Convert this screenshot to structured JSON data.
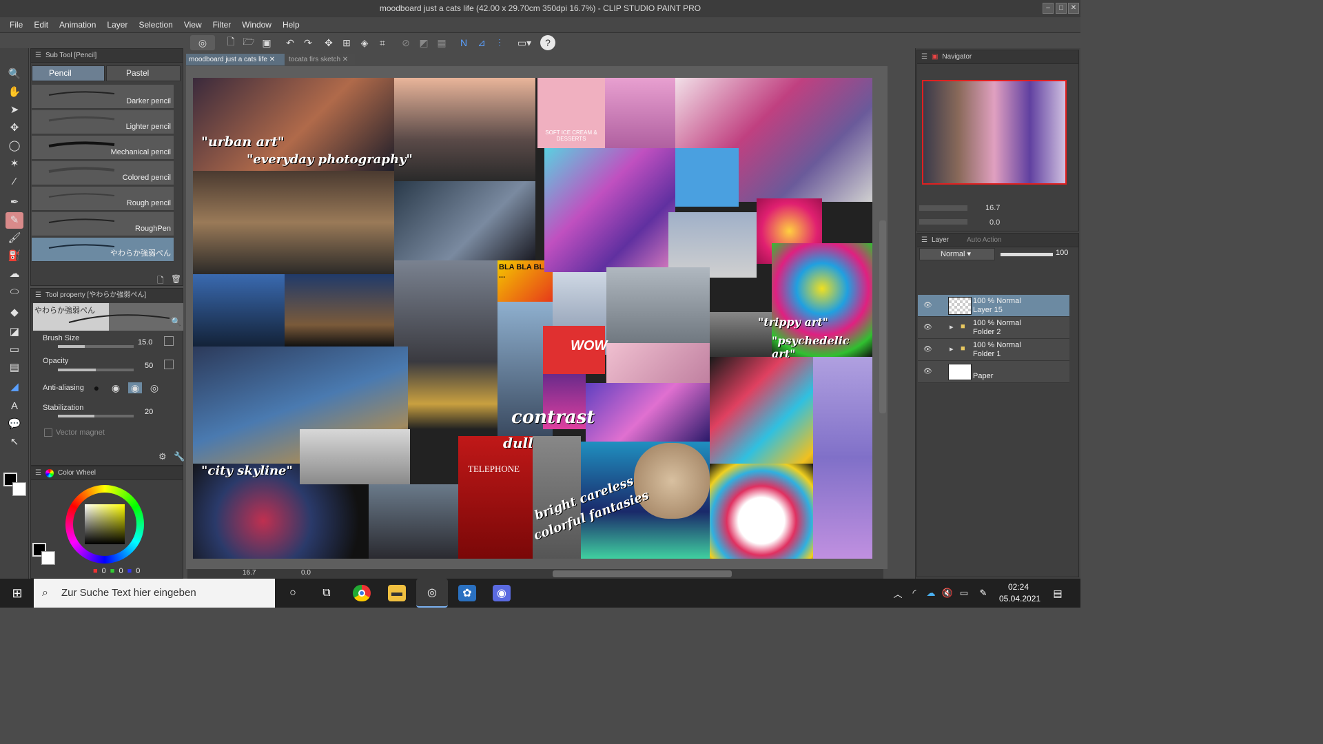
{
  "window": {
    "title": "moodboard just a cats life (42.00 x 29.70cm 350dpi 16.7%)  - CLIP STUDIO PAINT PRO"
  },
  "menu": [
    "File",
    "Edit",
    "Animation",
    "Layer",
    "Selection",
    "View",
    "Filter",
    "Window",
    "Help"
  ],
  "subtool": {
    "header": "Sub Tool [Pencil]",
    "tabs": [
      "Pencil",
      "Pastel"
    ],
    "brushes": [
      "Darker pencil",
      "Lighter pencil",
      "Mechanical pencil",
      "Colored pencil",
      "Rough pencil",
      "RoughPen",
      "やわらか強弱ぺん"
    ]
  },
  "toolprop": {
    "header": "Tool property [やわらか強弱ぺん]",
    "preview_name": "やわらか強弱ぺん",
    "brush_size_label": "Brush Size",
    "brush_size": "15.0",
    "opacity_label": "Opacity",
    "opacity": "50",
    "antialias_label": "Anti-aliasing",
    "stabilization_label": "Stabilization",
    "stabilization": "20",
    "vector_magnet_label": "Vector magnet",
    "brush_size_frac": 0.35,
    "opacity_frac": 0.5,
    "stabilization_frac": 0.48
  },
  "colorwheel": {
    "header": "Color Wheel",
    "r": "0",
    "g": "0",
    "b": "0"
  },
  "tabs": {
    "active": "moodboard just a cats life",
    "inactive": "tocata firs sketch"
  },
  "canvas_status": {
    "zoom": "16.7",
    "angle": "0.0"
  },
  "artwork": {
    "texts": [
      "\"urban art\"",
      "\"everyday photography\"",
      "BLA BLA BLA ...",
      "WOW",
      "\"trippy art\"",
      "\"psychedelic art\"",
      "contrast",
      "dull",
      "bright careless",
      "colorful fantasies",
      "\"city skyline\"",
      "SOFT ICE CREAM & DESSERTS",
      "TELEPHONE"
    ]
  },
  "navigator": {
    "header": "Navigator",
    "zoom": "16.7",
    "angle": "0.0"
  },
  "layers": {
    "header": "Layer",
    "tab2": "Auto Action",
    "blend": "Normal",
    "opacity": "100",
    "rows": [
      {
        "line1": "100 % Normal",
        "line2": "Layer 15"
      },
      {
        "line1": "100 % Normal",
        "line2": "Folder 2"
      },
      {
        "line1": "100 % Normal",
        "line2": "Folder 1"
      },
      {
        "line1": "",
        "line2": "Paper"
      }
    ]
  },
  "taskbar": {
    "search_placeholder": "Zur Suche Text hier eingeben",
    "time": "02:24",
    "date": "05.04.2021"
  }
}
